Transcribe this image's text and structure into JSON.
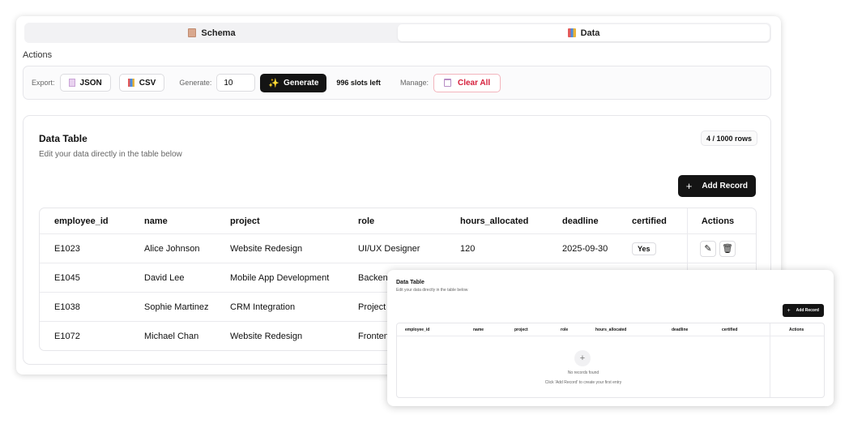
{
  "tabs": [
    {
      "label": "Schema",
      "icon": "document-icon"
    },
    {
      "label": "Data",
      "icon": "bar-chart-icon"
    }
  ],
  "actions": {
    "title": "Actions",
    "export_label": "Export:",
    "json_label": "JSON",
    "csv_label": "CSV",
    "generate_label": "Generate:",
    "generate_value": "10",
    "generate_button": "Generate",
    "slots_left": "996 slots left",
    "manage_label": "Manage:",
    "clear_label": "Clear All"
  },
  "table": {
    "title": "Data Table",
    "subtitle": "Edit your data directly in the table below",
    "rows_badge": "4 / 1000 rows",
    "add_label": "Add Record",
    "columns": [
      "employee_id",
      "name",
      "project",
      "role",
      "hours_allocated",
      "deadline",
      "certified",
      "Actions"
    ],
    "rows": [
      [
        "E1023",
        "Alice Johnson",
        "Website Redesign",
        "UI/UX Designer",
        "120",
        "2025-09-30",
        "Yes"
      ],
      [
        "E1045",
        "David Lee",
        "Mobile App Development",
        "Backend",
        "",
        "",
        ""
      ],
      [
        "E1038",
        "Sophie Martinez",
        "CRM Integration",
        "Project M",
        "",
        "",
        ""
      ],
      [
        "E1072",
        "Michael Chan",
        "Website Redesign",
        "Frontend",
        "",
        "",
        ""
      ]
    ]
  },
  "overlay": {
    "title": "Data Table",
    "subtitle": "Edit your data directly in the table below",
    "add_label": "Add Record",
    "columns": [
      "employee_id",
      "name",
      "project",
      "role",
      "hours_allocated",
      "deadline",
      "certified",
      "Actions"
    ],
    "empty_title": "No records found",
    "empty_hint": "Click 'Add Record' to create your first entry"
  }
}
